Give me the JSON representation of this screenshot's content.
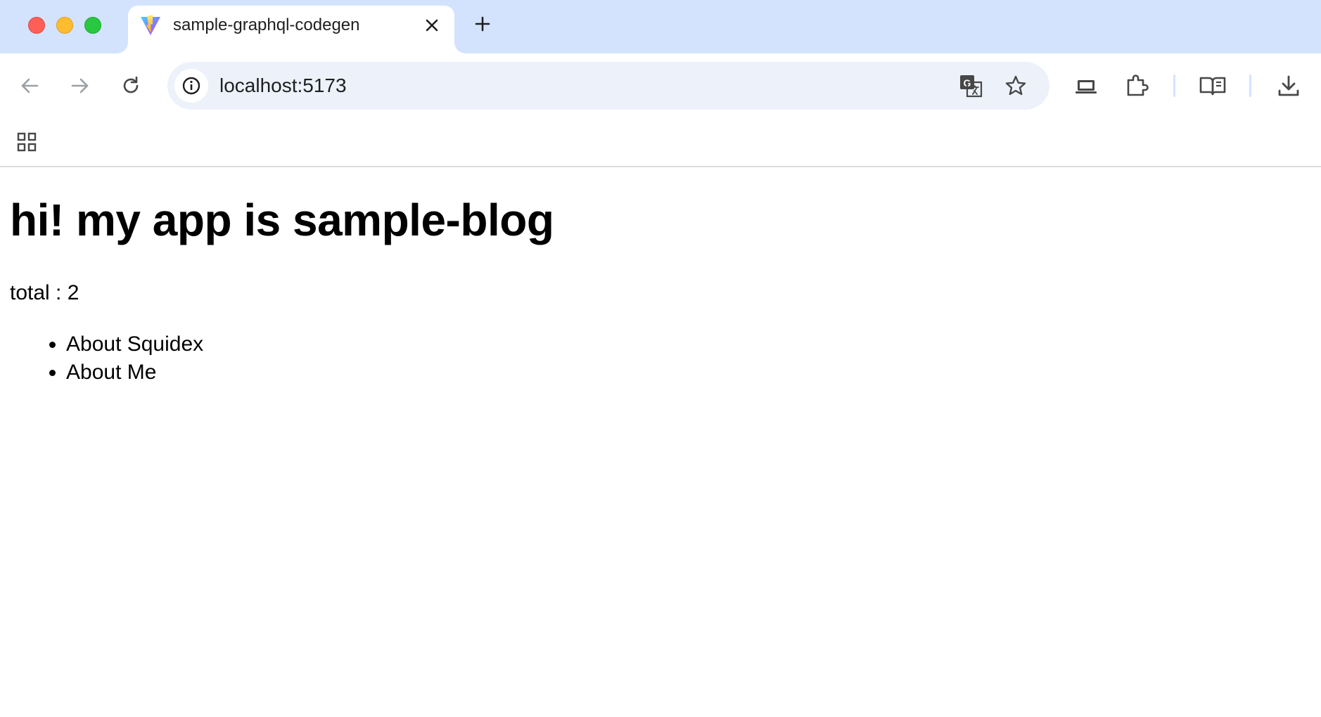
{
  "browser": {
    "tab": {
      "title": "sample-graphql-codegen",
      "favicon": "vite-logo-icon"
    },
    "address_bar": {
      "url": "localhost:5173"
    },
    "toolbar_icons": [
      "back-icon",
      "forward-icon",
      "reload-icon",
      "site-info-icon",
      "translate-icon",
      "bookmark-star-icon",
      "cast-icon",
      "extensions-icon",
      "reading-list-icon",
      "download-icon"
    ],
    "bookmarks_bar": {
      "apps_icon": "apps-grid-icon"
    },
    "colors": {
      "tabstrip": "#d3e3fd",
      "omnibox": "#edf2fa"
    }
  },
  "page": {
    "heading": "hi! my app is sample-blog",
    "total_label": "total : 2",
    "posts": [
      {
        "title": "About Squidex"
      },
      {
        "title": "About Me"
      }
    ]
  }
}
